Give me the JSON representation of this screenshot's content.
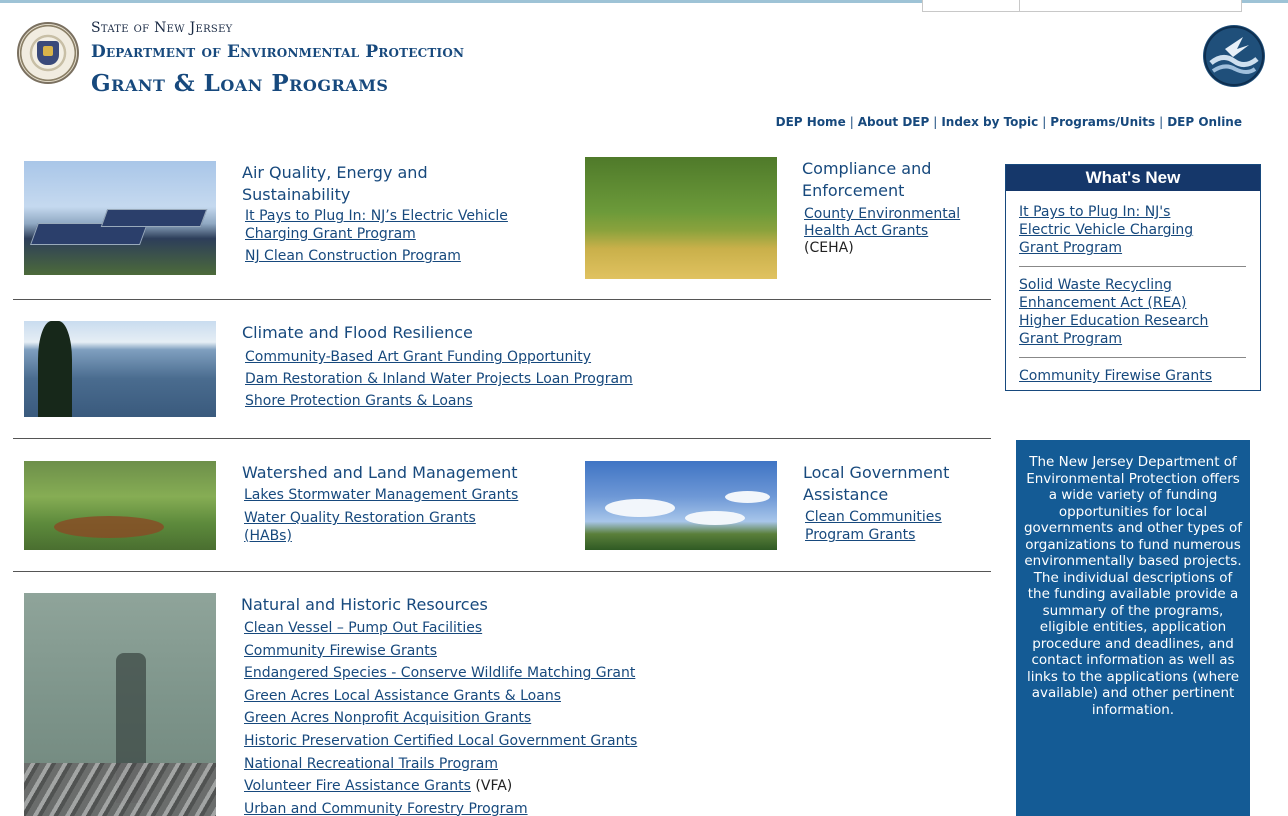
{
  "header": {
    "state": "State of New Jersey",
    "department": "Department of Environmental Protection",
    "subtitle": "Grant & Loan Programs"
  },
  "topnav": [
    "DEP Home",
    "About DEP",
    "Index by Topic",
    "Programs/Units",
    "DEP Online"
  ],
  "sections": {
    "air": {
      "title_line1": "Air Quality, Energy and",
      "title_line2": "Sustainability",
      "links": [
        {
          "line1": "It Pays to Plug In: NJ’s Electric Vehicle",
          "line2": "Charging Grant Program"
        },
        {
          "line1": "NJ Clean Construction Program"
        }
      ]
    },
    "compliance": {
      "title_line1": "Compliance and",
      "title_line2": "Enforcement",
      "link_line1": "County Environmental",
      "link_line2": "Health Act Grants",
      "suffix": "(CEHA)"
    },
    "climate": {
      "title": "Climate and Flood Resilience",
      "links": [
        "Community-Based Art Grant Funding Opportunity",
        "Dam Restoration & Inland Water Projects Loan Program",
        "Shore Protection Grants & Loans"
      ]
    },
    "watershed": {
      "title": "Watershed and Land Management",
      "links": [
        {
          "line1": "Lakes Stormwater Management Grants"
        },
        {
          "line1": "Water Quality Restoration Grants",
          "line2": "(HABs)"
        }
      ]
    },
    "localgov": {
      "title_line1": "Local Government",
      "title_line2": "Assistance",
      "link_line1": "Clean Communities",
      "link_line2": "Program Grants"
    },
    "natural": {
      "title": "Natural and Historic Resources",
      "links": [
        "Clean Vessel – Pump Out Facilities",
        "Community Firewise Grants",
        "Endangered Species - Conserve Wildlife Matching Grant",
        "Green Acres Local Assistance Grants & Loans",
        "Green Acres Nonprofit Acquisition Grants",
        "Historic Preservation Certified Local Government Grants",
        "National Recreational Trails Program",
        "Volunteer Fire Assistance Grants",
        "Urban and Community Forestry Program"
      ],
      "vfa_suffix": "(VFA)"
    }
  },
  "whats_new": {
    "title": "What's New",
    "items": [
      {
        "lines": [
          "It Pays to Plug In: NJ's",
          "Electric Vehicle Charging",
          "Grant Program"
        ]
      },
      {
        "lines": [
          "Solid Waste Recycling",
          "Enhancement Act (REA)",
          "Higher Education Research",
          "Grant Program"
        ]
      },
      {
        "lines": [
          "Community Firewise Grants"
        ]
      }
    ]
  },
  "info_box": {
    "text": "The New Jersey Department of Environmental Protection offers a wide variety of funding opportunities for local governments and other types of organizations to fund numerous environmentally based projects.  The individual descriptions of the funding available provide a summary of the programs, eligible entities, application procedure and deadlines, and contact information as well as links to the applications (where available) and other pertinent information."
  },
  "colors": {
    "link": "#17497d",
    "header_blue": "#15376a",
    "info_box_bg": "#145b95"
  },
  "icons": [
    "nj-state-seal-icon",
    "dep-logo-icon"
  ]
}
